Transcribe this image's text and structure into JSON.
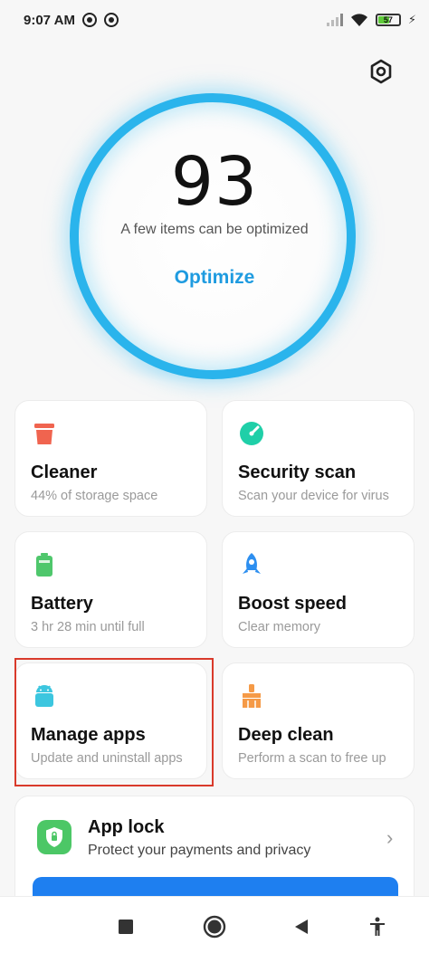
{
  "status_bar": {
    "time": "9:07 AM",
    "battery_level": "57",
    "battery_fraction": 0.57
  },
  "score": {
    "value": "93",
    "subtitle": "A few items can be optimized",
    "action_label": "Optimize"
  },
  "cards": [
    {
      "title": "Cleaner",
      "subtitle": "44% of storage space",
      "icon": "trash-icon",
      "color": "#f0644f"
    },
    {
      "title": "Security scan",
      "subtitle": "Scan your device for virus",
      "icon": "security-icon",
      "color": "#1fcfa8"
    },
    {
      "title": "Battery",
      "subtitle": "3 hr 28 min  until full",
      "icon": "battery-icon",
      "color": "#4fc76c"
    },
    {
      "title": "Boost speed",
      "subtitle": "Clear memory",
      "icon": "rocket-icon",
      "color": "#2d8ff0"
    },
    {
      "title": "Manage apps",
      "subtitle": "Update and uninstall apps",
      "icon": "android-icon",
      "color": "#3cc6df"
    },
    {
      "title": "Deep clean",
      "subtitle": "Perform a scan to free up",
      "icon": "broom-icon",
      "color": "#f59a47"
    }
  ],
  "app_lock": {
    "title": "App lock",
    "subtitle": "Protect your payments and privacy",
    "icon": "shield-icon",
    "color": "#4cc766"
  },
  "colors": {
    "accent": "#1e9be0",
    "ring": "#2ab4ec",
    "highlight": "#d93a2b"
  }
}
